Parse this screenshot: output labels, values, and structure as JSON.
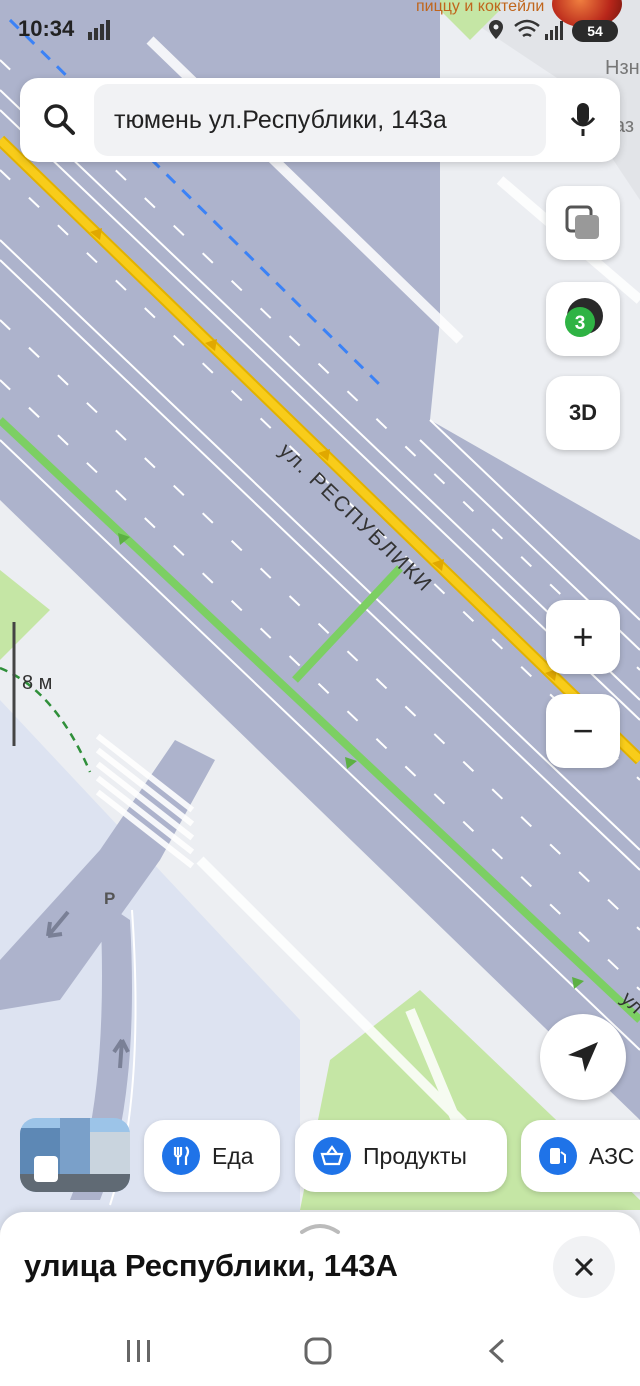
{
  "status_bar": {
    "time": "10:34",
    "ad_text": "пиццу и коктейли",
    "wifi_label": "5",
    "battery": "54"
  },
  "search": {
    "query": "тюмень ул.Республики, 143а"
  },
  "map": {
    "street_label": "ул. РЕСПУБЛИКИ",
    "top_right_fragments": [
      "Нзн",
      "аз"
    ],
    "right_edge_fragment": "ул",
    "parking_label": "P",
    "scale_label": "8 м",
    "colors": {
      "road": "#adb3cc",
      "ground": "#eceef2",
      "park": "#c5e6a5",
      "block": "#dde3f1",
      "route_yellow": "#f6c500",
      "route_green": "#7ccf63",
      "transit_line": "#3b82f6"
    }
  },
  "controls": {
    "layers_icon": "layers-icon",
    "traffic_level": "3",
    "view_3d_label": "3D",
    "zoom_in_label": "+",
    "zoom_out_label": "−",
    "locate_icon": "navigation-arrow-icon"
  },
  "categories": [
    {
      "label": "Еда",
      "icon": "fork-knife-icon"
    },
    {
      "label": "Продукты",
      "icon": "basket-icon"
    },
    {
      "label": "АЗС",
      "icon": "fuel-icon"
    }
  ],
  "bottom_sheet": {
    "title": "улица Республики, 143А"
  }
}
